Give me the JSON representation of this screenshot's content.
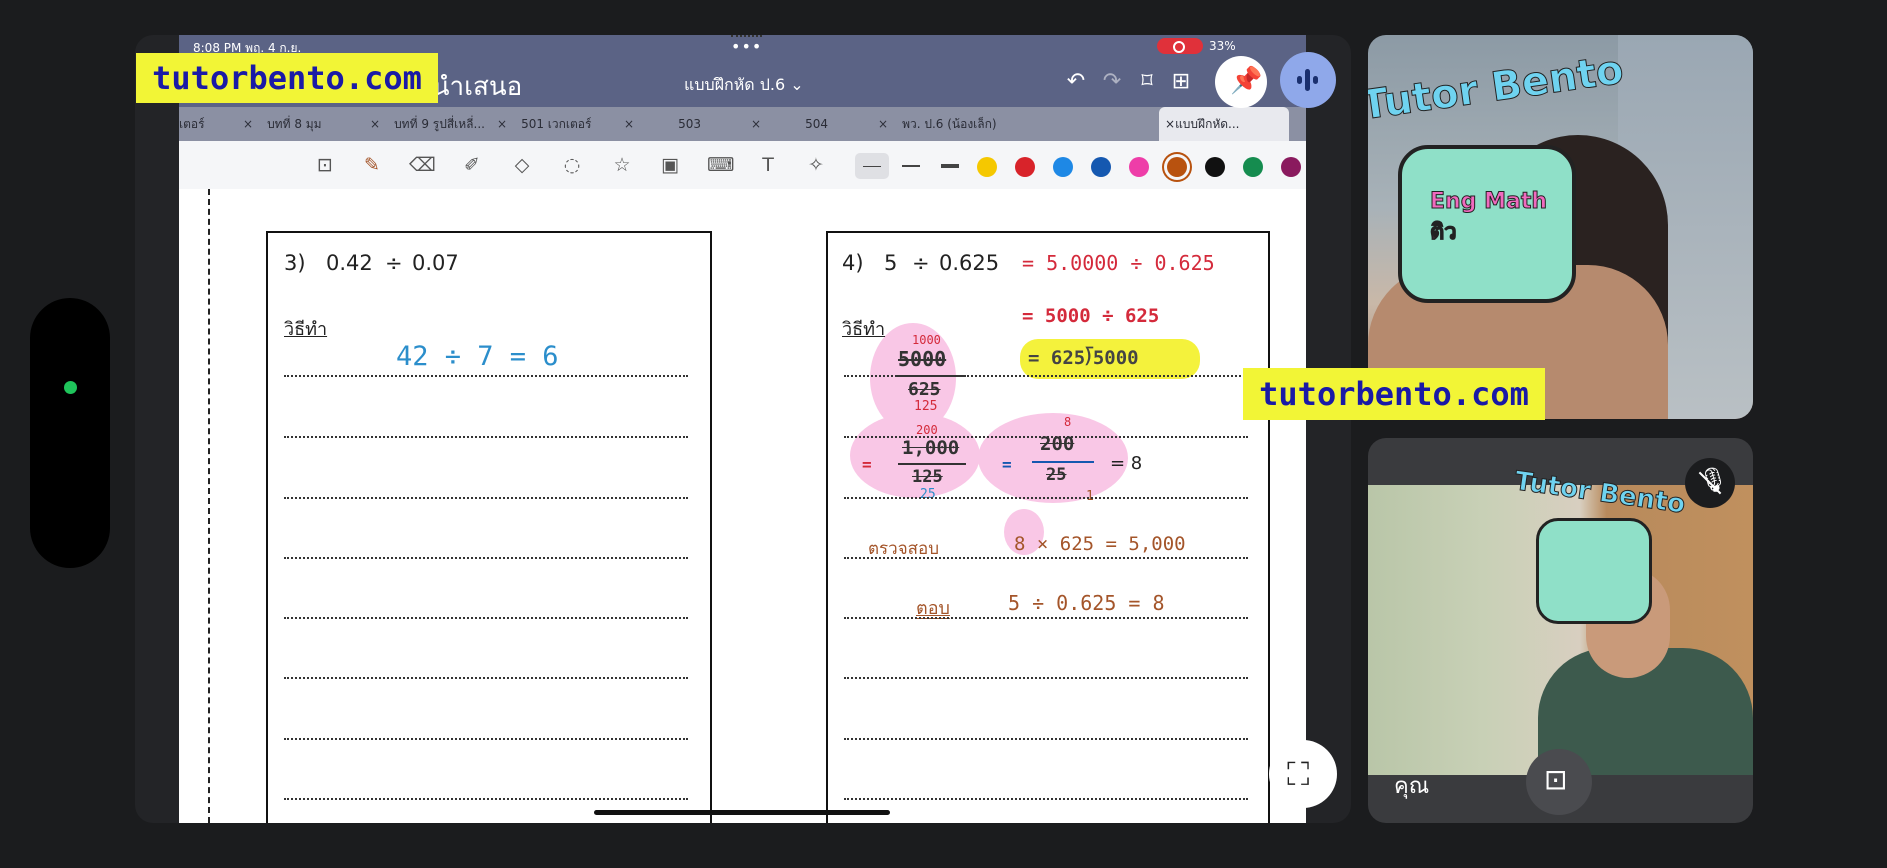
{
  "status_bar": {
    "time": "8:08 PM  พฤ. 4 ก.ย.",
    "dots": "•••",
    "battery": "33%"
  },
  "ipad_header": {
    "doc_title_partial": "งนำเสนอ",
    "notebook_title": "แบบฝึกหัด ป.6"
  },
  "tabs": [
    {
      "label": "เตอร์"
    },
    {
      "label": "บทที่ 8 มุม"
    },
    {
      "label": "บทที่ 9 รูปสี่เหลี่..."
    },
    {
      "label": "501 เวกเตอร์"
    },
    {
      "label": "503"
    },
    {
      "label": "504"
    },
    {
      "label": "พว. ป.6 (น้องเล็ก)"
    },
    {
      "label": "แบบฝึกหัด..."
    }
  ],
  "pen_colors": [
    "#f5c800",
    "#d8232a",
    "#1e88e5",
    "#1558b0",
    "#ee3da8",
    "#b8520f",
    "#111111",
    "#158c4f",
    "#8a1a5e"
  ],
  "worksheet": {
    "q3": {
      "number": "3)",
      "dividend": "0.42",
      "divisor": "0.07",
      "method_label": "วิธีทำ",
      "work_line1": "42 ÷ 7 = 6"
    },
    "q4": {
      "number": "4)",
      "dividend": "5",
      "divisor": "0.625",
      "method_label": "วิธีทำ",
      "step1": "= 5.0000 ÷ 0.625",
      "step2": "= 5000 ÷ 625",
      "step3": "= 625⟌5000",
      "frac1_top_small": "1000",
      "frac1_top": "5000",
      "frac1_bottom": "625",
      "frac1_bottom_small": "125",
      "frac2_top_small": "200",
      "frac2_top": "1,000",
      "frac2_bottom": "125",
      "frac2_bottom_small": "25",
      "frac3_top_small": "8",
      "frac3_top": "200",
      "frac3_bottom": "25",
      "frac3_bottom_small": "1",
      "result": "= 8",
      "check_label": "ตรวจสอบ",
      "check": "8 × 625  =  5,000",
      "answer_label": "ตอบ",
      "answer": "5 ÷ 0.625 = 8"
    }
  },
  "watermark": "tutorbento.com",
  "tile1": {
    "brand": "Tutor Bento",
    "sticker": "Eng Math ติว"
  },
  "tile2": {
    "brand": "Tutor Bento",
    "label": "คุณ"
  }
}
